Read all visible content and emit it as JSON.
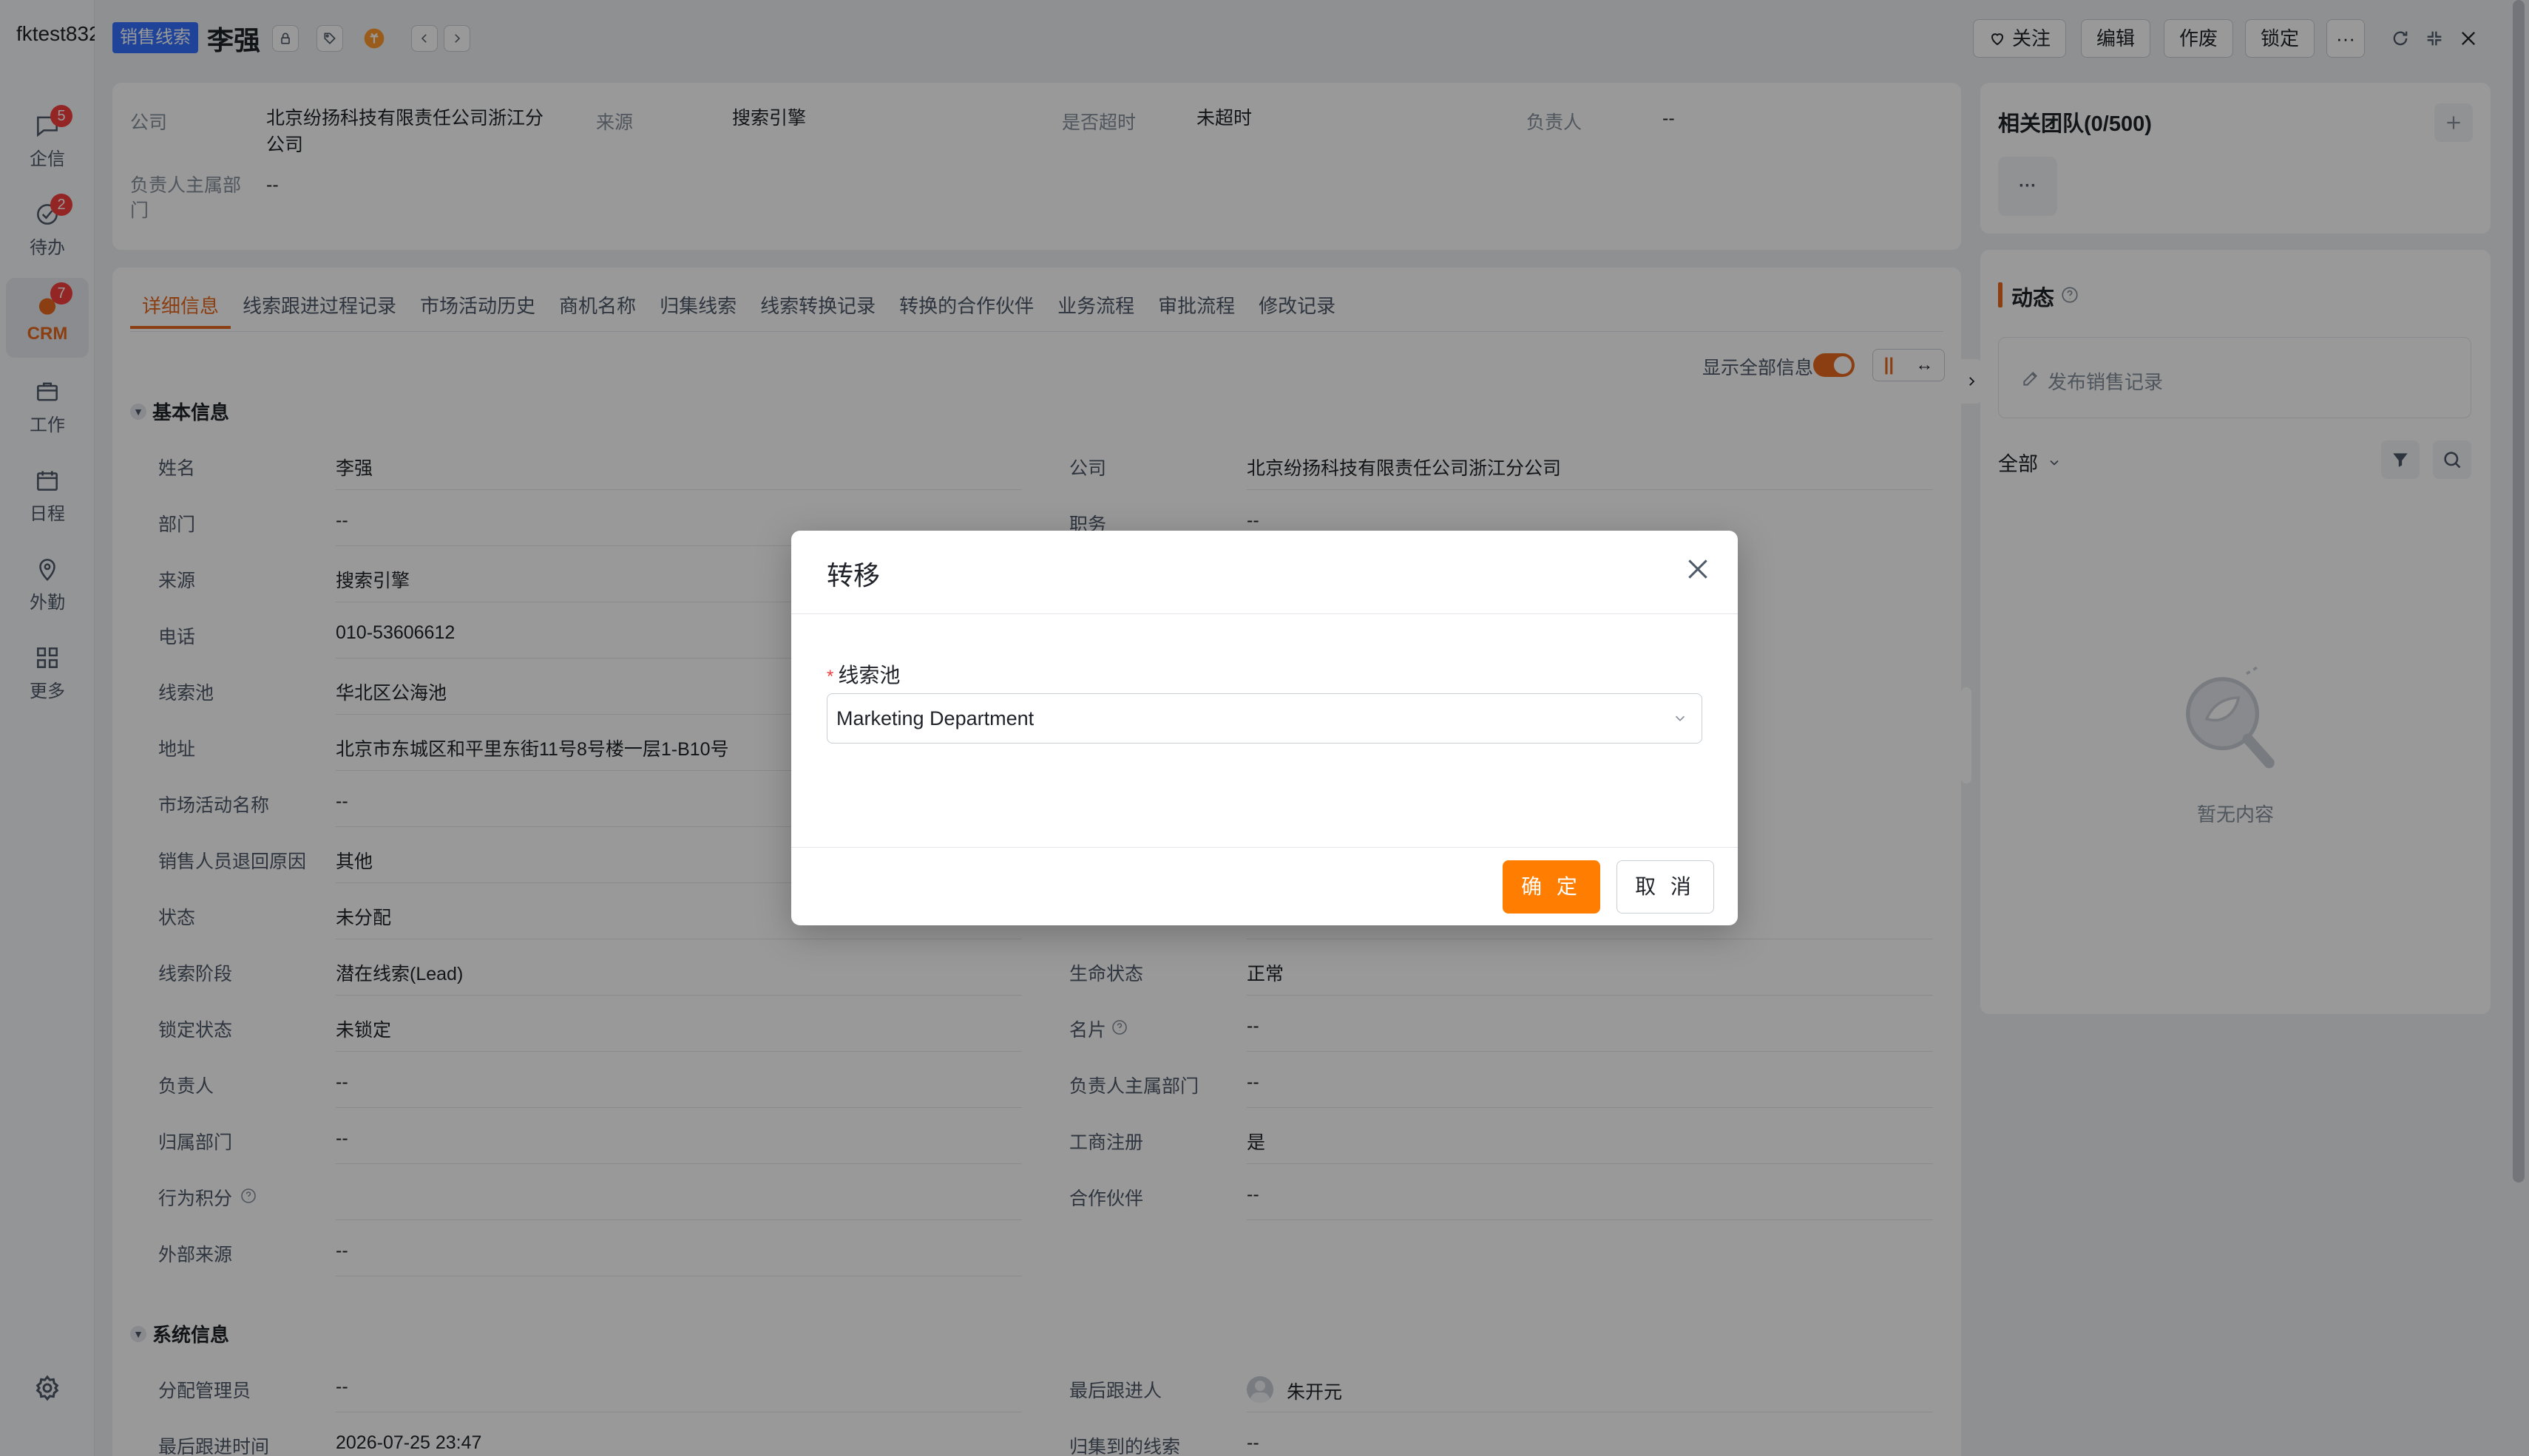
{
  "rail": {
    "tenant": "fktest832",
    "items": [
      {
        "label": "企信",
        "badge": "5"
      },
      {
        "label": "待办",
        "badge": "2"
      },
      {
        "label": "CRM",
        "badge": "7"
      },
      {
        "label": "工作"
      },
      {
        "label": "日程"
      },
      {
        "label": "外勤"
      },
      {
        "label": "更多"
      }
    ]
  },
  "header": {
    "tag": "销售线索",
    "title": "李强",
    "buttons": {
      "follow": "关注",
      "edit": "编辑",
      "void": "作废",
      "lock": "锁定",
      "more": "···"
    }
  },
  "summary": {
    "company_label": "公司",
    "company_value": "北京纷扬科技有限责任公司浙江分公司",
    "source_label": "来源",
    "source_value": "搜索引擎",
    "overtime_label": "是否超时",
    "overtime_value": "未超时",
    "owner_label": "负责人",
    "owner_value": "--",
    "owner_dept_label": "负责人主属部门",
    "owner_dept_value": "--"
  },
  "tabs": [
    "详细信息",
    "线索跟进过程记录",
    "市场活动历史",
    "商机名称",
    "归集线索",
    "线索转换记录",
    "转换的合作伙伴",
    "业务流程",
    "审批流程",
    "修改记录"
  ],
  "toolbar": {
    "show_all": "显示全部信息"
  },
  "basic": {
    "title": "基本信息",
    "left": [
      {
        "label": "姓名",
        "value": "李强"
      },
      {
        "label": "部门",
        "value": "--"
      },
      {
        "label": "来源",
        "value": "搜索引擎"
      },
      {
        "label": "电话",
        "value": "010-53606612"
      },
      {
        "label": "线索池",
        "value": "华北区公海池"
      },
      {
        "label": "地址",
        "value": "北京市东城区和平里东街11号8号楼一层1-B10号"
      },
      {
        "label": "市场活动名称",
        "value": "--"
      },
      {
        "label": "销售人员退回原因",
        "value": "其他"
      },
      {
        "label": "状态",
        "value": "未分配"
      },
      {
        "label": "线索阶段",
        "value": "潜在线索(Lead)"
      },
      {
        "label": "锁定状态",
        "value": "未锁定"
      },
      {
        "label": "负责人",
        "value": "--"
      },
      {
        "label": "归属部门",
        "value": "--"
      },
      {
        "label": "行为积分",
        "value": ""
      },
      {
        "label": "外部来源",
        "value": "--"
      }
    ],
    "right": [
      {
        "label": "公司",
        "value": "北京纷扬科技有限责任公司浙江分公司"
      },
      {
        "label": "职务",
        "value": "--"
      },
      {
        "label": "生命状态",
        "value": "正常"
      },
      {
        "label": "名片",
        "value": "--"
      },
      {
        "label": "负责人主属部门",
        "value": "--"
      },
      {
        "label": "工商注册",
        "value": "是"
      },
      {
        "label": "合作伙伴",
        "value": "--"
      }
    ]
  },
  "system": {
    "title": "系统信息",
    "left": [
      {
        "label": "分配管理员",
        "value": "--"
      },
      {
        "label": "最后跟进时间",
        "value": "2026-07-25 23:47"
      }
    ],
    "right": [
      {
        "label": "最后跟进人",
        "value": "朱开元"
      },
      {
        "label": "归集到的线索",
        "value": "--"
      }
    ]
  },
  "right_panel": {
    "team_title": "相关团队(0/500)",
    "team_more": "···",
    "feed_title": "动态",
    "post_placeholder": "发布销售记录",
    "filter_label": "全部",
    "empty_text": "暂无内容"
  },
  "modal": {
    "title": "转移",
    "field_label": "线索池",
    "required_mark": "*",
    "selected": "Marketing Department",
    "ok": "确 定",
    "cancel": "取 消"
  },
  "colors": {
    "accent": "#ff7d00",
    "tag_blue": "#3370ff",
    "badge_red": "#f53f3f"
  }
}
